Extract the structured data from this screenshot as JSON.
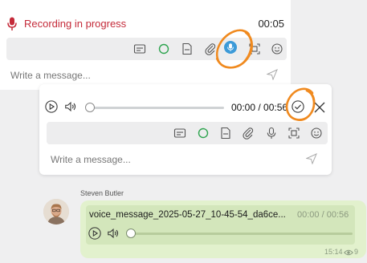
{
  "recording": {
    "status": "Recording in progress",
    "timer": "00:05"
  },
  "composer_top": {
    "placeholder": "Write a message..."
  },
  "preview": {
    "time": "00:00 / 00:56",
    "placeholder": "Write a message..."
  },
  "message": {
    "sender": "Steven Butler",
    "file_name": "voice_message_2025-05-27_10-45-54_da6ce...",
    "duration": "00:00 / 00:56",
    "sent_time": "15:14",
    "views": "9",
    "progress": 0
  },
  "toolbar_icons": [
    "subtitles-icon",
    "circle-icon",
    "gif-icon",
    "attach-icon",
    "mic-icon",
    "screen-capture-icon",
    "smile-icon"
  ],
  "colors": {
    "recording_red": "#c42a39",
    "mic_active_blue": "#3c9ad8",
    "highlight_orange": "#f08a1f",
    "bubble_green": "#e2f1cd"
  }
}
